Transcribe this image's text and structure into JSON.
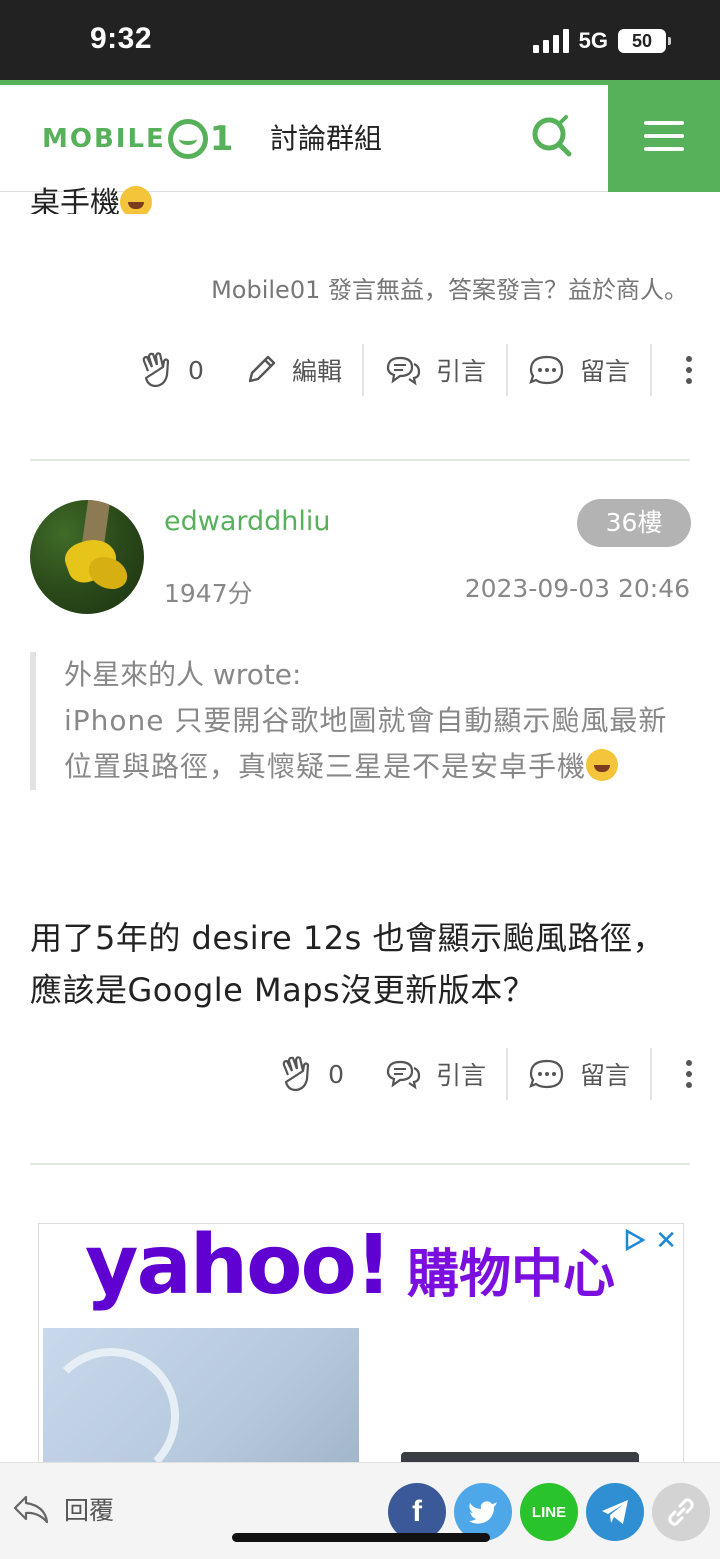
{
  "status_bar": {
    "time": "9:32",
    "network": "5G",
    "battery": "50"
  },
  "header": {
    "logo_text": "MOBILE",
    "logo_suffix": "1",
    "title": "討論群組"
  },
  "prev_post": {
    "partial_text": "桌手機",
    "signature": "Mobile01 發言無益，答案發言？益於商人。",
    "actions": {
      "like_count": "0",
      "edit": "編輯",
      "quote": "引言",
      "comment": "留言"
    }
  },
  "post": {
    "username": "edwarddhliu",
    "floor": "36樓",
    "score": "1947分",
    "timestamp": "2023-09-03 20:46",
    "quote_author": "外星來的人 wrote:",
    "quote_text": "iPhone 只要開谷歌地圖就會自動顯示颱風最新位置與路徑，真懷疑三星是不是安卓手機",
    "body": "用了5年的 desire 12s 也會顯示颱風路徑，應該是Google Maps沒更新版本？",
    "actions": {
      "like_count": "0",
      "quote": "引言",
      "comment": "留言"
    }
  },
  "ad": {
    "brand": "yahoo!",
    "title": "購物中心",
    "close": "✕"
  },
  "bottom_bar": {
    "reply": "回覆",
    "share_facebook": "f",
    "share_line": "LINE"
  }
}
